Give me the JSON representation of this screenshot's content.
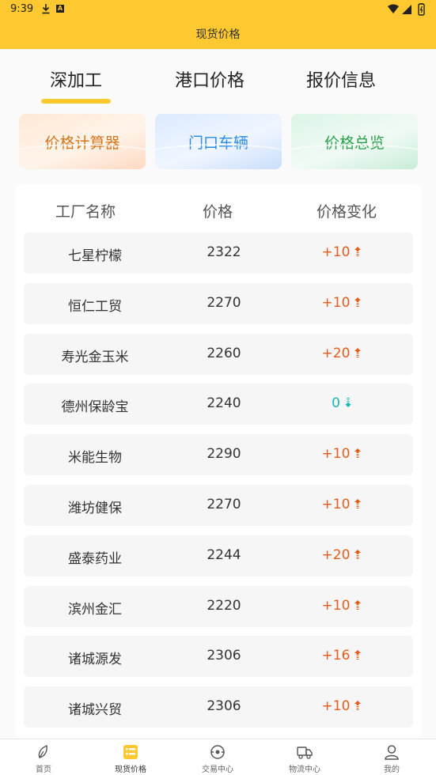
{
  "status_bar": {
    "time": "9:39",
    "a_badge": "A"
  },
  "header": {
    "title": "现货价格"
  },
  "tabs": [
    {
      "label": "深加工"
    },
    {
      "label": "港口价格"
    },
    {
      "label": "报价信息"
    }
  ],
  "quick_links": [
    {
      "label": "价格计算器"
    },
    {
      "label": "门口车辆"
    },
    {
      "label": "价格总览"
    }
  ],
  "table": {
    "headers": [
      "工厂名称",
      "价格",
      "价格变化"
    ],
    "rows": [
      {
        "name": "七星柠檬",
        "price": "2322",
        "change": "+10",
        "direction": "up"
      },
      {
        "name": "恒仁工贸",
        "price": "2270",
        "change": "+10",
        "direction": "up"
      },
      {
        "name": "寿光金玉米",
        "price": "2260",
        "change": "+20",
        "direction": "up"
      },
      {
        "name": "德州保龄宝",
        "price": "2240",
        "change": "0",
        "direction": "flat"
      },
      {
        "name": "米能生物",
        "price": "2290",
        "change": "+10",
        "direction": "up"
      },
      {
        "name": "潍坊健保",
        "price": "2270",
        "change": "+10",
        "direction": "up"
      },
      {
        "name": "盛泰药业",
        "price": "2244",
        "change": "+20",
        "direction": "up"
      },
      {
        "name": "滨州金汇",
        "price": "2220",
        "change": "+10",
        "direction": "up"
      },
      {
        "name": "诸城源发",
        "price": "2306",
        "change": "+16",
        "direction": "up"
      },
      {
        "name": "诸城兴贸",
        "price": "2306",
        "change": "+10",
        "direction": "up"
      }
    ]
  },
  "tabbar": [
    {
      "label": "首页",
      "icon": "home-leaf-icon"
    },
    {
      "label": "现货价格",
      "icon": "price-list-icon"
    },
    {
      "label": "交易中心",
      "icon": "trade-center-icon"
    },
    {
      "label": "物流中心",
      "icon": "truck-icon"
    },
    {
      "label": "我的",
      "icon": "user-icon"
    }
  ],
  "colors": {
    "accent": "#fdc830",
    "up": "#ea5a1c",
    "flat": "#18b5b8",
    "calc": "#d2761a",
    "vehicle": "#2b8ae4",
    "overview": "#2ba04c"
  }
}
